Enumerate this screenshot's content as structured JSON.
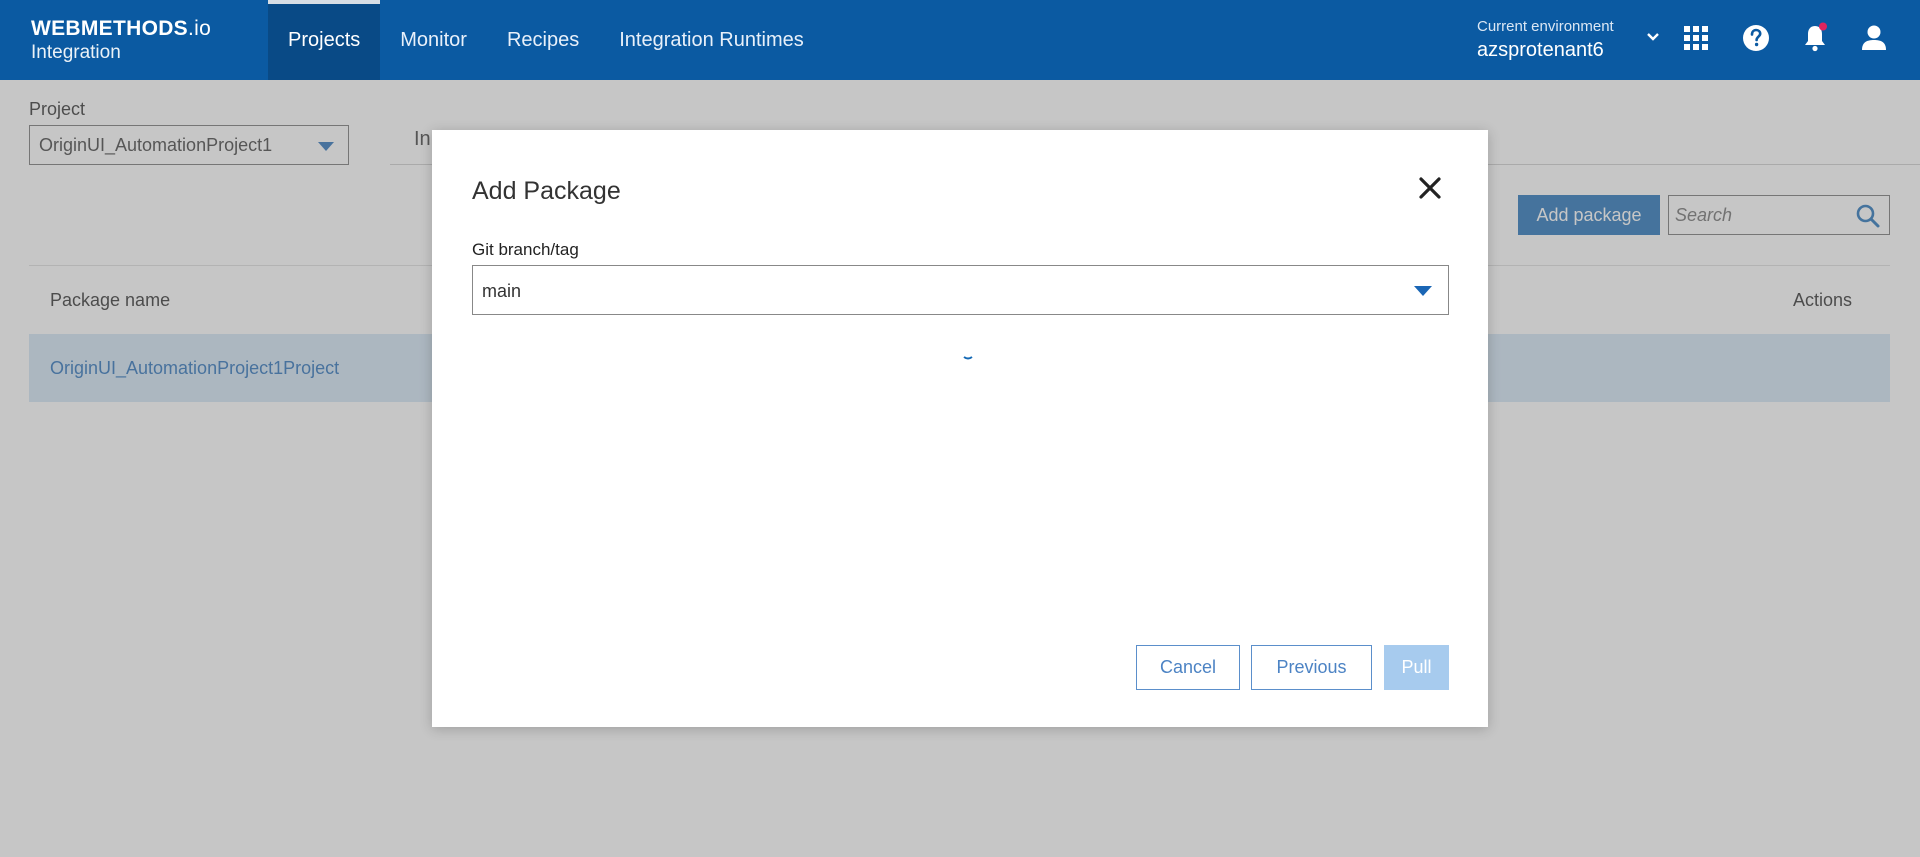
{
  "header": {
    "brand_line1": "WEBMETHODS",
    "brand_line1_suffix": ".io",
    "brand_line2": "Integration",
    "nav": [
      {
        "label": "Projects",
        "active": true
      },
      {
        "label": "Monitor",
        "active": false
      },
      {
        "label": "Recipes",
        "active": false
      },
      {
        "label": "Integration Runtimes",
        "active": false
      }
    ],
    "env_label": "Current environment",
    "env_value": "azsprotenant6",
    "icons": [
      "chevron-down-icon",
      "apps-grid-icon",
      "help-icon",
      "bell-icon",
      "user-icon"
    ],
    "notification_dot_color": "#e0245e",
    "bar_color": "#0b5aa2"
  },
  "page": {
    "project_label": "Project",
    "project_value": "OriginUI_AutomationProject1",
    "tab_partial": "In",
    "add_package_label": "Add package",
    "search_placeholder": "Search",
    "table": {
      "headers": {
        "name": "Package name",
        "actions": "Actions"
      },
      "rows": [
        {
          "name": "OriginUI_AutomationProject1Project"
        }
      ]
    }
  },
  "dialog": {
    "title": "Add Package",
    "branch_label": "Git branch/tag",
    "branch_value": "main",
    "buttons": {
      "cancel": "Cancel",
      "previous": "Previous",
      "pull": "Pull"
    },
    "pull_disabled": true
  },
  "colors": {
    "accent": "#1469b5",
    "link": "#1a66b5",
    "row_highlight": "#cfe3f5"
  }
}
